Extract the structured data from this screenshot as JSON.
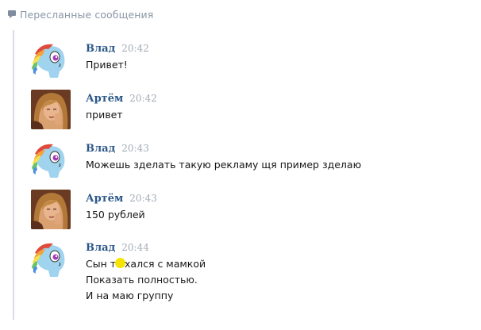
{
  "header": {
    "title": "Пересланные сообщения",
    "icon": "message-icon"
  },
  "messages": [
    {
      "author": "Влад",
      "time": "20:42",
      "avatar": "pony-avatar",
      "lines": [
        "Привет!"
      ]
    },
    {
      "author": "Артём",
      "time": "20:42",
      "avatar": "girl-photo-avatar",
      "lines": [
        "привет"
      ]
    },
    {
      "author": "Влад",
      "time": "20:43",
      "avatar": "pony-avatar",
      "lines": [
        "Можешь зделать такую рекламу щя пример зделаю"
      ]
    },
    {
      "author": "Артём",
      "time": "20:43",
      "avatar": "girl-photo-avatar",
      "lines": [
        "150 рублей"
      ]
    },
    {
      "author": "Влад",
      "time": "20:44",
      "avatar": "pony-avatar",
      "lines": [
        "Сын т",
        "хался с мамкой",
        "Показать полностью.",
        "И на маю группу"
      ]
    }
  ],
  "colors": {
    "author": "#2b5787",
    "time": "#a3acb7",
    "header": "#8a97a6",
    "text": "#151515",
    "thread_line": "#d8dde4",
    "censor_dot": "#f5e400"
  }
}
